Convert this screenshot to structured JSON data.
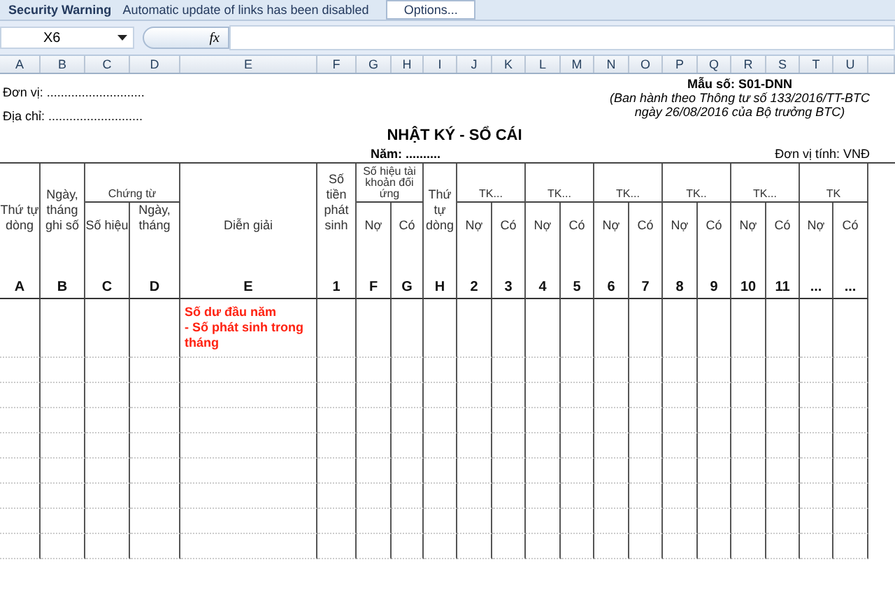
{
  "security_bar": {
    "title": "Security Warning",
    "message": "Automatic update of links has been disabled",
    "button": "Options..."
  },
  "formula_bar": {
    "name_box": "X6",
    "function_label": "fx"
  },
  "column_headers": [
    "A",
    "B",
    "C",
    "D",
    "E",
    "F",
    "G",
    "H",
    "I",
    "J",
    "K",
    "L",
    "M",
    "N",
    "O",
    "P",
    "Q",
    "R",
    "S",
    "T",
    "U"
  ],
  "sheet": {
    "unit": "Đơn vị: ............................",
    "address": "Địa chỉ: ...........................",
    "form_no": "Mẫu số: S01-DNN",
    "issued": "(Ban hành theo Thông tư số 133/2016/TT-BTC",
    "issued_date": "ngày 26/08/2016  của Bộ trưởng BTC)",
    "title": "NHẬT KÝ - SỔ CÁI",
    "year": "Năm: ..........",
    "currency": "Đơn vị tính: VNĐ"
  },
  "table": {
    "columns": [
      {
        "label": "Thứ tự dòng",
        "code": "A"
      },
      {
        "label": "Ngày, tháng ghi số",
        "code": "B"
      },
      {
        "group": "Chứng từ",
        "sub": [
          {
            "label": "Số hiệu",
            "code": "C"
          },
          {
            "label": "Ngày, tháng",
            "code": "D"
          }
        ]
      },
      {
        "label": "Diễn giải",
        "code": "E"
      },
      {
        "label": "Số tiền phát sinh",
        "code": "1"
      },
      {
        "group": "Số hiệu tài khoản đối ứng",
        "sub": [
          {
            "label": "Nợ",
            "code": "F"
          },
          {
            "label": "Có",
            "code": "G"
          }
        ]
      },
      {
        "label": "Thứ tự dòng",
        "code": "H"
      },
      {
        "group": "TK...",
        "sub": [
          {
            "label": "Nợ",
            "code": "2"
          },
          {
            "label": "Có",
            "code": "3"
          }
        ]
      },
      {
        "group": "TK...",
        "sub": [
          {
            "label": "Nợ",
            "code": "4"
          },
          {
            "label": "Có",
            "code": "5"
          }
        ]
      },
      {
        "group": "TK...",
        "sub": [
          {
            "label": "Nợ",
            "code": "6"
          },
          {
            "label": "Có",
            "code": "7"
          }
        ]
      },
      {
        "group": "TK..",
        "sub": [
          {
            "label": "Nợ",
            "code": "8"
          },
          {
            "label": "Có",
            "code": "9"
          }
        ]
      },
      {
        "group": "TK...",
        "sub": [
          {
            "label": "Nợ",
            "code": "10"
          },
          {
            "label": "Có",
            "code": "11"
          }
        ]
      },
      {
        "group": "TK",
        "sub": [
          {
            "label": "Nợ",
            "code": "..."
          },
          {
            "label": "Có",
            "code": "..."
          }
        ]
      }
    ],
    "note_lines": [
      "Số dư đầu năm",
      "- Số phát sinh trong tháng"
    ]
  }
}
